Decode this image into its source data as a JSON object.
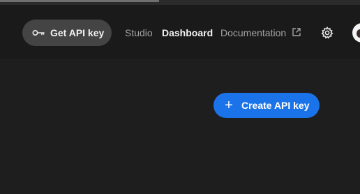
{
  "header": {
    "api_key_button": "Get API key",
    "nav": [
      {
        "label": "Studio",
        "active": false
      },
      {
        "label": "Dashboard",
        "active": true
      },
      {
        "label": "Documentation",
        "active": false
      }
    ],
    "icons": [
      "key-icon",
      "external-link-icon",
      "gear-icon",
      "avatar"
    ]
  },
  "main": {
    "create_button": "Create API key",
    "create_icon": "plus-icon"
  },
  "colors": {
    "background": "#1e1e1e",
    "header_background": "#1a1a1a",
    "chip_background": "#444444",
    "accent": "#1a73e8",
    "nav_inactive": "#a3a3a3",
    "nav_active": "#f3f3f3"
  }
}
